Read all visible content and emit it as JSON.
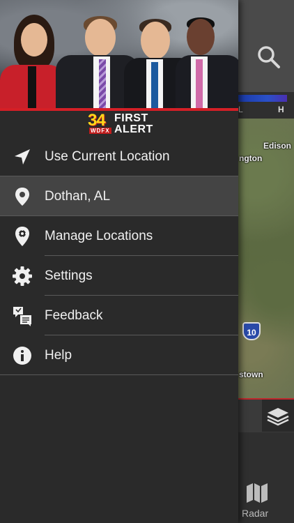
{
  "brand": {
    "station_number": "34",
    "call_sign": "WDFX",
    "line1": "FIRST",
    "line2": "ALERT"
  },
  "menu": {
    "items": [
      {
        "label": "Use Current Location",
        "icon": "location-arrow-icon",
        "selected": false
      },
      {
        "label": "Dothan, AL",
        "icon": "map-pin-icon",
        "selected": true
      },
      {
        "label": "Manage Locations",
        "icon": "manage-locations-icon",
        "selected": false
      },
      {
        "label": "Settings",
        "icon": "gear-icon",
        "selected": false
      },
      {
        "label": "Feedback",
        "icon": "feedback-icon",
        "selected": false
      },
      {
        "label": "Help",
        "icon": "info-icon",
        "selected": false
      }
    ]
  },
  "background_app": {
    "legend": {
      "low": "L",
      "high": "H"
    },
    "map_labels": [
      "Edison",
      "ngton",
      "stown"
    ],
    "highway": "10",
    "bottom_nav": {
      "radar_label": "Radar"
    }
  },
  "colors": {
    "accent_red": "#d41f26",
    "drawer_bg": "#2a2a2a",
    "selected_bg": "#444444",
    "logo_yellow": "#ffd81a"
  }
}
